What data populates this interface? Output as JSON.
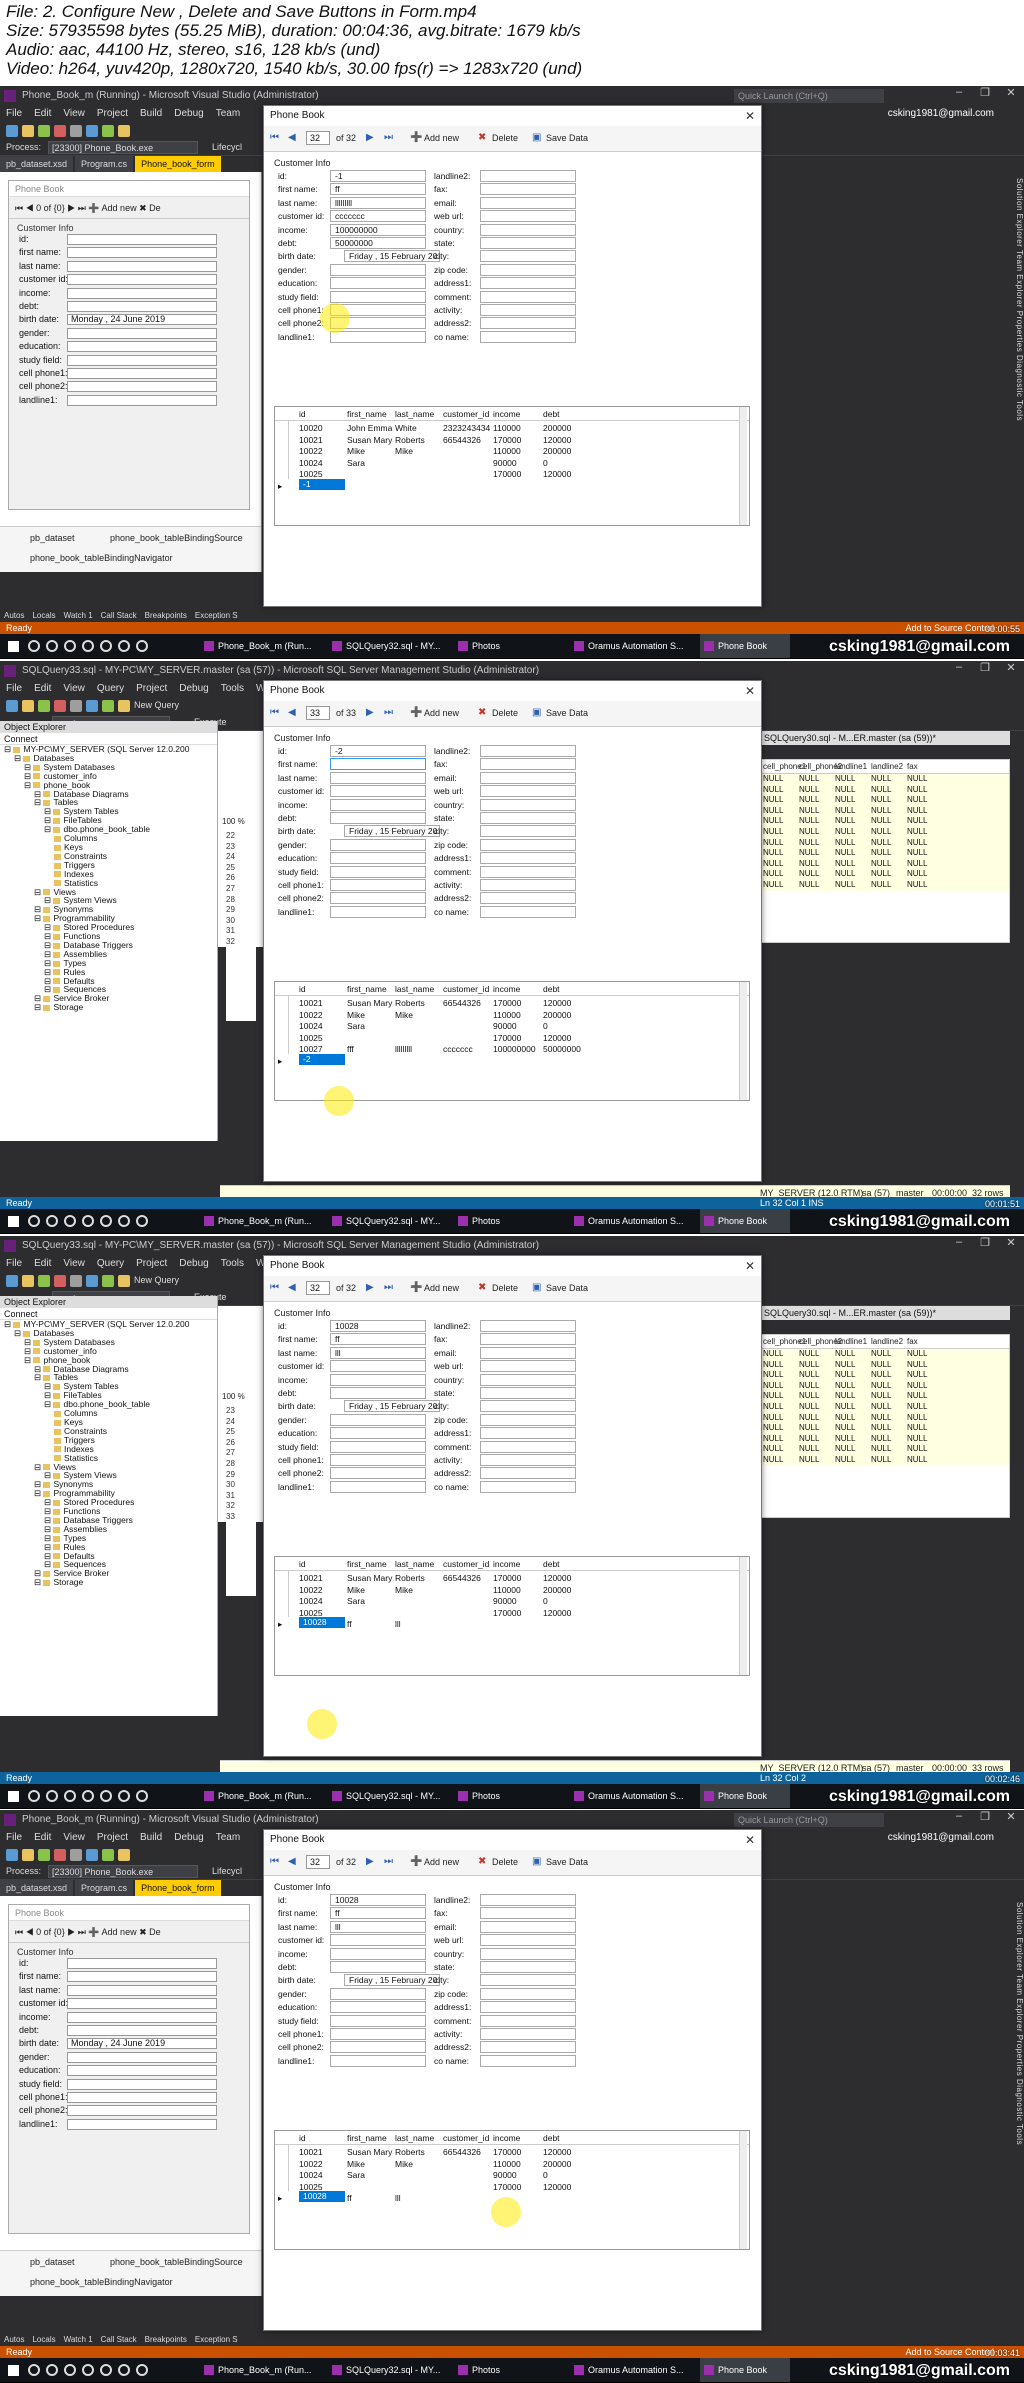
{
  "header": {
    "lines": [
      "File: 2. Configure New , Delete and Save Buttons in Form.mp4",
      "Size: 57935598 bytes (55.25 MiB), duration: 00:04:36, avg.bitrate: 1679 kb/s",
      "Audio: aac, 44100 Hz, stereo, s16, 128 kb/s (und)",
      "Video: h264, yuv420p, 1280x720, 1540 kb/s, 30.00 fps(r) => 1283x720 (und)"
    ]
  },
  "vs": {
    "title": "Phone_Book_m (Running) - Microsoft Visual Studio (Administrator)",
    "menu": [
      "File",
      "Edit",
      "View",
      "Project",
      "Build",
      "Debug",
      "Team"
    ],
    "quick_launch": "Quick Launch (Ctrl+Q)",
    "user": "csking1981@gmail.com",
    "process_label": "Process:",
    "process_value": "[23300] Phone_Book.exe",
    "lifecycle": "Lifecycl",
    "tabs": [
      "pb_dataset.xsd",
      "Program.cs",
      "Phone_book_form"
    ],
    "bg_form_title": "Phone Book",
    "bg_nav": {
      "pos": "0",
      "of": "of {0}",
      "add": "Add new",
      "del": "De"
    },
    "bg_group": "Customer Info",
    "bg_fields": [
      "id:",
      "first name:",
      "last name:",
      "customer id:",
      "income:",
      "debt:",
      "birth date:",
      "gender:",
      "education:",
      "study field:",
      "cell phone1:",
      "cell phone2:",
      "landline1:"
    ],
    "bg_birth": "Monday  , 24   June    2019",
    "tray": [
      "pb_dataset",
      "phone_book_tableBindingSource",
      "phone_book_tableBindingNavigator"
    ],
    "right_tools": "Solution Explorer  Team Explorer  Properties  Diagnostic Tools",
    "bottom_tabs": [
      "Autos",
      "Locals",
      "Watch 1",
      "Call Stack",
      "Breakpoints",
      "Exception S"
    ],
    "status_ready": "Ready",
    "status_source": "Add to Source Control"
  },
  "ssms": {
    "title": "SQLQuery33.sql - MY-PC\\MY_SERVER.master (sa (57)) - Microsoft SQL Server Management Studio (Administrator)",
    "menu": [
      "File",
      "Edit",
      "View",
      "Query",
      "Project",
      "Debug",
      "Tools",
      "Window"
    ],
    "db_select": "master",
    "execute": "Execute",
    "new_query": "New Query",
    "obj_explorer": "Object Explorer",
    "connect": "Connect",
    "sql_tab": "SQLQuery30.sql - M...ER.master (sa (59))*",
    "tree": [
      {
        "t": "MY-PC\\MY_SERVER (SQL Server 12.0.200",
        "d": 0
      },
      {
        "t": "Databases",
        "d": 1
      },
      {
        "t": "System Databases",
        "d": 2
      },
      {
        "t": "customer_info",
        "d": 2
      },
      {
        "t": "phone_book",
        "d": 2
      },
      {
        "t": "Database Diagrams",
        "d": 3
      },
      {
        "t": "Tables",
        "d": 3
      },
      {
        "t": "System Tables",
        "d": 4
      },
      {
        "t": "FileTables",
        "d": 4
      },
      {
        "t": "dbo.phone_book_table",
        "d": 4
      },
      {
        "t": "Columns",
        "d": 5
      },
      {
        "t": "Keys",
        "d": 5
      },
      {
        "t": "Constraints",
        "d": 5
      },
      {
        "t": "Triggers",
        "d": 5
      },
      {
        "t": "Indexes",
        "d": 5
      },
      {
        "t": "Statistics",
        "d": 5
      },
      {
        "t": "Views",
        "d": 3
      },
      {
        "t": "System Views",
        "d": 4
      },
      {
        "t": "Synonyms",
        "d": 3
      },
      {
        "t": "Programmability",
        "d": 3
      },
      {
        "t": "Stored Procedures",
        "d": 4
      },
      {
        "t": "Functions",
        "d": 4
      },
      {
        "t": "Database Triggers",
        "d": 4
      },
      {
        "t": "Assemblies",
        "d": 4
      },
      {
        "t": "Types",
        "d": 4
      },
      {
        "t": "Rules",
        "d": 4
      },
      {
        "t": "Defaults",
        "d": 4
      },
      {
        "t": "Sequences",
        "d": 4
      },
      {
        "t": "Service Broker",
        "d": 3
      },
      {
        "t": "Storage",
        "d": 3
      }
    ],
    "results_cols": [
      "cell_phone1",
      "cell_phone2",
      "landline1",
      "landline2",
      "fax"
    ],
    "null": "NULL",
    "zoom": "100 %",
    "status_server": "MY_SERVER (12.0 RTM)",
    "status_user": "sa (57)",
    "status_db": "master",
    "status_time": "00:00:00",
    "status_ready": "Ready"
  },
  "taskbar": {
    "items": [
      "Phone_Book_m (Run...",
      "SQLQuery32.sql - MY...",
      "Photos",
      "Oramus Automation S...",
      "Phone Book"
    ]
  },
  "dialog": {
    "title": "Phone Book",
    "add": "Add new",
    "delete": "Delete",
    "save": "Save Data",
    "group": "Customer Info",
    "left_labels": [
      "id:",
      "first name:",
      "last name:",
      "customer id:",
      "income:",
      "debt:",
      "birth date:",
      "gender:",
      "education:",
      "study field:",
      "cell phone1:",
      "cell phone2:",
      "landline1:"
    ],
    "right_labels": [
      "landline2:",
      "fax:",
      "email:",
      "web url:",
      "country:",
      "state:",
      "city:",
      "zip code:",
      "address1:",
      "comment:",
      "activity:",
      "address2:",
      "co name:"
    ],
    "grid_cols": [
      "id",
      "first_name",
      "last_name",
      "customer_id",
      "income",
      "debt"
    ]
  },
  "frames": [
    {
      "ts": "00:00:55",
      "pos": "32",
      "of": "of 32",
      "values": {
        "id": "-1",
        "first": "ff",
        "last": "lllllllll",
        "cust": "ccccccc",
        "income": "100000000",
        "debt": "50000000",
        "birth": "Friday  , 15  February  2019"
      },
      "rows": [
        [
          "10020",
          "John Emma",
          "White",
          "2323243434",
          "110000",
          "200000"
        ],
        [
          "10021",
          "Susan Mary",
          "Roberts",
          "66544326",
          "170000",
          "120000"
        ],
        [
          "10022",
          "Mike",
          "Mike",
          "",
          "110000",
          "200000"
        ],
        [
          "10024",
          "Sara",
          "",
          "",
          "90000",
          "0"
        ],
        [
          "10025",
          "",
          "",
          "",
          "170000",
          "120000"
        ]
      ],
      "new_row": "-1",
      "status": "Ready",
      "status_right": "Add to Source Control"
    },
    {
      "ts": "00:01:51",
      "pos": "33",
      "of": "of 33",
      "values": {
        "id": "-2",
        "first": "",
        "last": "",
        "cust": "",
        "income": "",
        "debt": "",
        "birth": "Friday  , 15  February  2019"
      },
      "rows": [
        [
          "10021",
          "Susan Mary",
          "Roberts",
          "66544326",
          "170000",
          "120000"
        ],
        [
          "10022",
          "Mike",
          "Mike",
          "",
          "110000",
          "200000"
        ],
        [
          "10024",
          "Sara",
          "",
          "",
          "90000",
          "0"
        ],
        [
          "10025",
          "",
          "",
          "",
          "170000",
          "120000"
        ],
        [
          "10027",
          "fff",
          "lllllllll",
          "ccccccc",
          "100000000",
          "50000000"
        ]
      ],
      "new_row": "-2",
      "row_nums": [
        "22",
        "23",
        "24",
        "25",
        "26",
        "27",
        "28",
        "29",
        "30",
        "31",
        "32"
      ],
      "status": "Ready",
      "status_right": "Ln 32    Col 1    INS",
      "rows_count": "32 rows"
    },
    {
      "ts": "00:02:46",
      "pos": "32",
      "of": "of 32",
      "values": {
        "id": "10028",
        "first": "ff",
        "last": "lll",
        "cust": "",
        "income": "",
        "debt": "",
        "birth": "Friday  , 15  February  2019"
      },
      "rows": [
        [
          "10021",
          "Susan Mary",
          "Roberts",
          "66544326",
          "170000",
          "120000"
        ],
        [
          "10022",
          "Mike",
          "Mike",
          "",
          "110000",
          "200000"
        ],
        [
          "10024",
          "Sara",
          "",
          "",
          "90000",
          "0"
        ],
        [
          "10025",
          "",
          "",
          "",
          "170000",
          "120000"
        ]
      ],
      "new_row": "10028",
      "new_row_first": "ff",
      "new_row_last": "lll",
      "row_nums": [
        "23",
        "24",
        "25",
        "26",
        "27",
        "28",
        "29",
        "30",
        "31",
        "32",
        "33"
      ],
      "status": "Ready",
      "status_right": "Ln 32    Col 2",
      "rows_count": "33 rows"
    },
    {
      "ts": "00:03:41",
      "pos": "32",
      "of": "of 32",
      "values": {
        "id": "10028",
        "first": "ff",
        "last": "lll",
        "cust": "",
        "income": "",
        "debt": "",
        "birth": "Friday  , 15  February  2019"
      },
      "rows": [
        [
          "10021",
          "Susan Mary",
          "Roberts",
          "66544326",
          "170000",
          "120000"
        ],
        [
          "10022",
          "Mike",
          "Mike",
          "",
          "110000",
          "200000"
        ],
        [
          "10024",
          "Sara",
          "",
          "",
          "90000",
          "0"
        ],
        [
          "10025",
          "",
          "",
          "",
          "170000",
          "120000"
        ]
      ],
      "new_row": "10028",
      "new_row_first": "ff",
      "new_row_last": "lll",
      "status": "Ready",
      "status_right": "Add to Source Control"
    }
  ]
}
